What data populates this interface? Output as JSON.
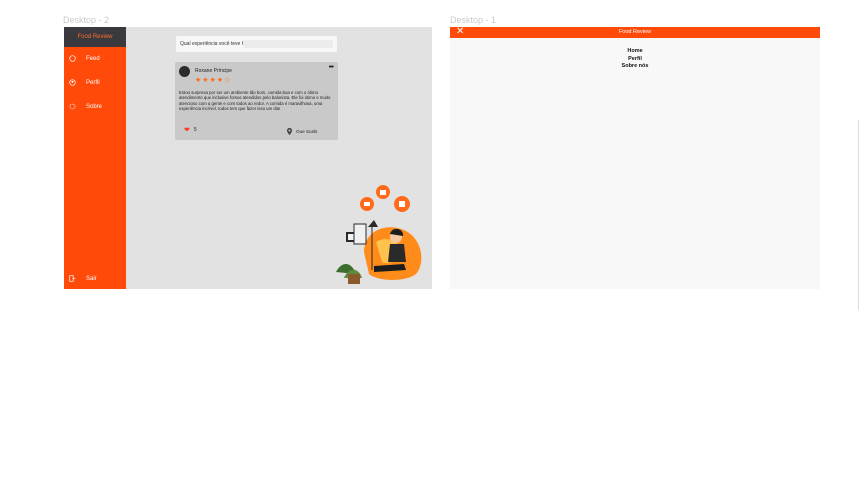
{
  "frames": {
    "left_label": "Desktop - 2",
    "right_label": "Desktop - 1"
  },
  "sidebar": {
    "title": "Food Review",
    "items": [
      {
        "label": "Feed",
        "icon": "home-icon"
      },
      {
        "label": "Perfil",
        "icon": "user-icon"
      },
      {
        "label": "Sobre",
        "icon": "gear-icon"
      }
    ],
    "logout": {
      "label": "Sair",
      "icon": "logout-icon"
    }
  },
  "feed": {
    "question": "Qual experiência você teve hoje?",
    "post": {
      "author": "Roxane Príncipe",
      "stars": "★★★★☆",
      "text": "Estou surpresa por ser um ambiente tão bom, comida boa e com o ótimo atendimento que inclusive fomos atendidos pelo balonista. Ele foi ótimo e muito atencioso com a gente e com todos ao redor. A comida é maravilhosa, uma experiência incrível, todos tem que fazer isso um dia!",
      "likes": "5",
      "place": "Oue Sushi"
    }
  },
  "menu_screen": {
    "title": "Food Review",
    "items": [
      "Home",
      "Perfil",
      "Sobre nós"
    ]
  },
  "colors": {
    "accent": "#ff4a0a",
    "sidebar_header": "#3a3a3e",
    "feed_bg": "#e2e2e2"
  }
}
